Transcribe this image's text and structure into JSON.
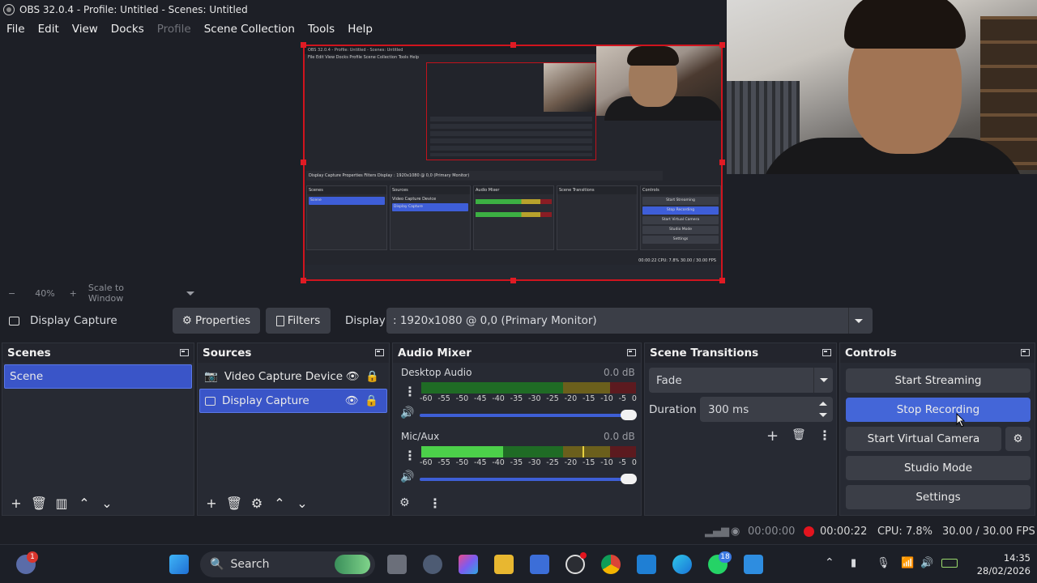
{
  "window": {
    "title": "OBS 32.0.4 - Profile: Untitled - Scenes: Untitled"
  },
  "menu": {
    "items": [
      "File",
      "Edit",
      "View",
      "Docks",
      "Profile",
      "Scene Collection",
      "Tools",
      "Help"
    ]
  },
  "preview": {
    "zoom": "40%",
    "scale_mode": "Scale to Window"
  },
  "mini": {
    "title": "OBS 32.0.4 - Profile: Untitled - Scenes: Untitled",
    "menu": "File  Edit  View  Docks  Profile  Scene Collection  Tools  Help",
    "source_bar": "Display Capture    Properties   Filters   Display  : 1920x1080 @ 0,0 (Primary Monitor)",
    "scenes": "Scenes",
    "scene": "Scene",
    "sources": "Sources",
    "src1": "Video Capture Device",
    "src2": "Display Capture",
    "mixer": "Audio Mixer",
    "transitions": "Scene Transitions",
    "controls": "Controls",
    "btns": [
      "Start Streaming",
      "Stop Recording",
      "Start Virtual Camera",
      "Studio Mode",
      "Settings"
    ],
    "status": "00:00:22   CPU: 7.8%   30.00 / 30.00 FPS"
  },
  "source_bar": {
    "source_name": "Display Capture",
    "properties": "Properties",
    "filters": "Filters",
    "display_label": "Display",
    "display_value": ": 1920x1080 @ 0,0 (Primary Monitor)"
  },
  "scenes": {
    "title": "Scenes",
    "items": [
      "Scene"
    ]
  },
  "sources": {
    "title": "Sources",
    "items": [
      "Video Capture Device",
      "Display Capture"
    ]
  },
  "mixer": {
    "title": "Audio Mixer",
    "channels": [
      {
        "name": "Desktop Audio",
        "db": "0.0 dB",
        "level": 0.0
      },
      {
        "name": "Mic/Aux",
        "db": "0.0 dB",
        "level": 0.38
      }
    ],
    "scale": [
      "-60",
      "-55",
      "-50",
      "-45",
      "-40",
      "-35",
      "-30",
      "-25",
      "-20",
      "-15",
      "-10",
      "-5",
      "0"
    ]
  },
  "transitions": {
    "title": "Scene Transitions",
    "transition": "Fade",
    "duration_label": "Duration",
    "duration_value": "300 ms"
  },
  "controls": {
    "title": "Controls",
    "start_streaming": "Start Streaming",
    "stop_recording": "Stop Recording",
    "start_virtual_camera": "Start Virtual Camera",
    "studio_mode": "Studio Mode",
    "settings": "Settings"
  },
  "status": {
    "stream_time": "00:00:00",
    "rec_time": "00:00:22",
    "cpu": "CPU: 7.8%",
    "fps": "30.00 / 30.00 FPS"
  },
  "taskbar": {
    "search": "Search",
    "time": "14:35",
    "date": "28/02/2026",
    "badge_notif": "1",
    "badge_whatsapp": "18"
  },
  "colors": {
    "accent": "#4466d8",
    "record": "#e3141e",
    "bg": "#1d1f26"
  }
}
